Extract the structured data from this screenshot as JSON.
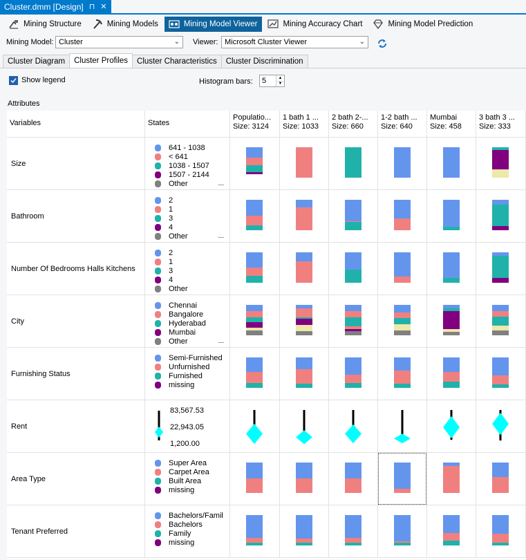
{
  "doc_tab": {
    "title": "Cluster.dmm [Design]",
    "pin_icon": "pin-icon",
    "close_icon": "close-icon"
  },
  "toolbar": [
    {
      "label": "Mining Structure",
      "icon": "mining-structure-icon",
      "active": false
    },
    {
      "label": "Mining Models",
      "icon": "pickaxe-icon",
      "active": false
    },
    {
      "label": "Mining Model Viewer",
      "icon": "viewer-icon",
      "active": true
    },
    {
      "label": "Mining Accuracy Chart",
      "icon": "accuracy-chart-icon",
      "active": false
    },
    {
      "label": "Mining Model Prediction",
      "icon": "prediction-icon",
      "active": false
    }
  ],
  "mining_model": {
    "label": "Mining Model:",
    "value": "Cluster"
  },
  "viewer": {
    "label": "Viewer:",
    "value": "Microsoft Cluster Viewer"
  },
  "subtabs": [
    {
      "label": "Cluster Diagram",
      "active": false
    },
    {
      "label": "Cluster Profiles",
      "active": true
    },
    {
      "label": "Cluster Characteristics",
      "active": false
    },
    {
      "label": "Cluster Discrimination",
      "active": false
    }
  ],
  "show_legend": {
    "label": "Show legend",
    "checked": true
  },
  "histogram": {
    "label": "Histogram bars:",
    "value": "5"
  },
  "attributes_label": "Attributes",
  "columns": {
    "variables": "Variables",
    "states": "States",
    "clusters": [
      {
        "name": "Populatio...",
        "size": "Size: 3124"
      },
      {
        "name": "1 bath 1 ...",
        "size": "Size: 1033"
      },
      {
        "name": "2 bath 2-...",
        "size": "Size: 660"
      },
      {
        "name": "1-2 bath ...",
        "size": "Size: 640"
      },
      {
        "name": "Mumbai",
        "size": "Size: 458"
      },
      {
        "name": "3 bath 3 ...",
        "size": "Size: 333"
      }
    ]
  },
  "colors": {
    "blue": "#6495ed",
    "salmon": "#f08080",
    "teal": "#20b2aa",
    "purple": "#800080",
    "gray": "#808080",
    "khaki": "#eee8aa",
    "cyan": "#00ffff",
    "select_blue": "#0e639c"
  },
  "rows": [
    {
      "name": "Size",
      "states": [
        {
          "label": "641 - 1038",
          "color": "#6495ed"
        },
        {
          "label": "< 641",
          "color": "#f08080"
        },
        {
          "label": "1038 - 1507",
          "color": "#20b2aa"
        },
        {
          "label": "1507 - 2144",
          "color": "#800080"
        },
        {
          "label": "Other",
          "color": "#808080"
        }
      ],
      "has_more": true,
      "bars": [
        [
          {
            "v": 0.35,
            "c": "#6495ed"
          },
          {
            "v": 0.25,
            "c": "#f08080"
          },
          {
            "v": 0.22,
            "c": "#20b2aa"
          },
          {
            "v": 0.06,
            "c": "#800080"
          },
          {
            "v": 0.12,
            "c": "#ffffff"
          }
        ],
        [
          {
            "v": 1.0,
            "c": "#f08080"
          }
        ],
        [
          {
            "v": 1.0,
            "c": "#20b2aa"
          }
        ],
        [
          {
            "v": 1.0,
            "c": "#6495ed"
          }
        ],
        [
          {
            "v": 1.0,
            "c": "#6495ed"
          }
        ],
        [
          {
            "v": 0.08,
            "c": "#20b2aa"
          },
          {
            "v": 0.65,
            "c": "#800080"
          },
          {
            "v": 0.27,
            "c": "#eee8aa"
          }
        ]
      ]
    },
    {
      "name": "Bathroom",
      "states": [
        {
          "label": "2",
          "color": "#6495ed"
        },
        {
          "label": "1",
          "color": "#f08080"
        },
        {
          "label": "3",
          "color": "#20b2aa"
        },
        {
          "label": "4",
          "color": "#800080"
        },
        {
          "label": "Other",
          "color": "#808080"
        }
      ],
      "has_more": true,
      "bars": [
        [
          {
            "v": 0.52,
            "c": "#6495ed"
          },
          {
            "v": 0.33,
            "c": "#f08080"
          },
          {
            "v": 0.15,
            "c": "#20b2aa"
          }
        ],
        [
          {
            "v": 0.25,
            "c": "#6495ed"
          },
          {
            "v": 0.75,
            "c": "#f08080"
          }
        ],
        [
          {
            "v": 0.7,
            "c": "#6495ed"
          },
          {
            "v": 0.03,
            "c": "#f08080"
          },
          {
            "v": 0.27,
            "c": "#20b2aa"
          }
        ],
        [
          {
            "v": 0.62,
            "c": "#6495ed"
          },
          {
            "v": 0.38,
            "c": "#f08080"
          }
        ],
        [
          {
            "v": 0.88,
            "c": "#6495ed"
          },
          {
            "v": 0.12,
            "c": "#20b2aa"
          }
        ],
        [
          {
            "v": 0.15,
            "c": "#6495ed"
          },
          {
            "v": 0.72,
            "c": "#20b2aa"
          },
          {
            "v": 0.13,
            "c": "#800080"
          }
        ]
      ]
    },
    {
      "name": "Number Of Bedrooms Halls Kitchens",
      "states": [
        {
          "label": "2",
          "color": "#6495ed"
        },
        {
          "label": "1",
          "color": "#f08080"
        },
        {
          "label": "3",
          "color": "#20b2aa"
        },
        {
          "label": "4",
          "color": "#800080"
        },
        {
          "label": "Other",
          "color": "#808080"
        }
      ],
      "has_more": false,
      "bars": [
        [
          {
            "v": 0.49,
            "c": "#6495ed"
          },
          {
            "v": 0.29,
            "c": "#f08080"
          },
          {
            "v": 0.22,
            "c": "#20b2aa"
          }
        ],
        [
          {
            "v": 0.3,
            "c": "#6495ed"
          },
          {
            "v": 0.7,
            "c": "#f08080"
          }
        ],
        [
          {
            "v": 0.57,
            "c": "#6495ed"
          },
          {
            "v": 0.43,
            "c": "#20b2aa"
          }
        ],
        [
          {
            "v": 0.8,
            "c": "#6495ed"
          },
          {
            "v": 0.2,
            "c": "#f08080"
          }
        ],
        [
          {
            "v": 0.85,
            "c": "#6495ed"
          },
          {
            "v": 0.15,
            "c": "#20b2aa"
          }
        ],
        [
          {
            "v": 0.12,
            "c": "#6495ed"
          },
          {
            "v": 0.73,
            "c": "#20b2aa"
          },
          {
            "v": 0.15,
            "c": "#800080"
          }
        ]
      ]
    },
    {
      "name": "City",
      "states": [
        {
          "label": "Chennai",
          "color": "#6495ed"
        },
        {
          "label": "Bangalore",
          "color": "#f08080"
        },
        {
          "label": "Hyderabad",
          "color": "#20b2aa"
        },
        {
          "label": "Mumbai",
          "color": "#800080"
        },
        {
          "label": "Other",
          "color": "#808080"
        }
      ],
      "has_more": true,
      "bars": [
        [
          {
            "v": 0.2,
            "c": "#6495ed"
          },
          {
            "v": 0.2,
            "c": "#f08080"
          },
          {
            "v": 0.17,
            "c": "#20b2aa"
          },
          {
            "v": 0.17,
            "c": "#800080"
          },
          {
            "v": 0.1,
            "c": "#eee8aa"
          },
          {
            "v": 0.16,
            "c": "#808080"
          }
        ],
        [
          {
            "v": 0.12,
            "c": "#6495ed"
          },
          {
            "v": 0.28,
            "c": "#f08080"
          },
          {
            "v": 0.06,
            "c": "#20b2aa"
          },
          {
            "v": 0.2,
            "c": "#800080"
          },
          {
            "v": 0.2,
            "c": "#eee8aa"
          },
          {
            "v": 0.14,
            "c": "#808080"
          }
        ],
        [
          {
            "v": 0.2,
            "c": "#6495ed"
          },
          {
            "v": 0.2,
            "c": "#f08080"
          },
          {
            "v": 0.3,
            "c": "#20b2aa"
          },
          {
            "v": 0.1,
            "c": "#f08080"
          },
          {
            "v": 0.06,
            "c": "#800080"
          },
          {
            "v": 0.14,
            "c": "#808080"
          }
        ],
        [
          {
            "v": 0.24,
            "c": "#6495ed"
          },
          {
            "v": 0.2,
            "c": "#f08080"
          },
          {
            "v": 0.2,
            "c": "#20b2aa"
          },
          {
            "v": 0.2,
            "c": "#eee8aa"
          },
          {
            "v": 0.16,
            "c": "#808080"
          }
        ],
        [
          {
            "v": 0.12,
            "c": "#6495ed"
          },
          {
            "v": 0.08,
            "c": "#20b2aa"
          },
          {
            "v": 0.6,
            "c": "#800080"
          },
          {
            "v": 0.08,
            "c": "#eee8aa"
          },
          {
            "v": 0.12,
            "c": "#808080"
          }
        ],
        [
          {
            "v": 0.2,
            "c": "#6495ed"
          },
          {
            "v": 0.18,
            "c": "#f08080"
          },
          {
            "v": 0.3,
            "c": "#20b2aa"
          },
          {
            "v": 0.17,
            "c": "#eee8aa"
          },
          {
            "v": 0.15,
            "c": "#808080"
          }
        ]
      ]
    },
    {
      "name": "Furnishing Status",
      "states": [
        {
          "label": "Semi-Furnished",
          "color": "#6495ed"
        },
        {
          "label": "Unfurnished",
          "color": "#f08080"
        },
        {
          "label": "Furnished",
          "color": "#20b2aa"
        },
        {
          "label": "missing",
          "color": "#800080"
        }
      ],
      "has_more": false,
      "bars": [
        [
          {
            "v": 0.47,
            "c": "#6495ed"
          },
          {
            "v": 0.38,
            "c": "#f08080"
          },
          {
            "v": 0.15,
            "c": "#20b2aa"
          }
        ],
        [
          {
            "v": 0.38,
            "c": "#6495ed"
          },
          {
            "v": 0.48,
            "c": "#f08080"
          },
          {
            "v": 0.14,
            "c": "#20b2aa"
          }
        ],
        [
          {
            "v": 0.56,
            "c": "#6495ed"
          },
          {
            "v": 0.28,
            "c": "#f08080"
          },
          {
            "v": 0.16,
            "c": "#20b2aa"
          }
        ],
        [
          {
            "v": 0.43,
            "c": "#6495ed"
          },
          {
            "v": 0.44,
            "c": "#f08080"
          },
          {
            "v": 0.13,
            "c": "#20b2aa"
          }
        ],
        [
          {
            "v": 0.47,
            "c": "#6495ed"
          },
          {
            "v": 0.33,
            "c": "#f08080"
          },
          {
            "v": 0.2,
            "c": "#20b2aa"
          }
        ],
        [
          {
            "v": 0.58,
            "c": "#6495ed"
          },
          {
            "v": 0.3,
            "c": "#f08080"
          },
          {
            "v": 0.12,
            "c": "#20b2aa"
          }
        ]
      ]
    },
    {
      "name": "Rent",
      "is_continuous": true,
      "states_numeric": {
        "max": "83,567.53",
        "mean": "22,943.05",
        "min": "1,200.00"
      },
      "rent": [
        {
          "top": 0.0,
          "bottom": 0.88,
          "mean": 0.72,
          "spread": 0.9
        },
        {
          "top": 0.0,
          "bottom": 0.9,
          "mean": 0.82,
          "spread": 0.55
        },
        {
          "top": 0.0,
          "bottom": 0.9,
          "mean": 0.72,
          "spread": 0.82
        },
        {
          "top": 0.0,
          "bottom": 0.92,
          "mean": 0.86,
          "spread": 0.3
        },
        {
          "top": 0.0,
          "bottom": 0.9,
          "mean": 0.52,
          "spread": 1.0
        },
        {
          "top": 0.0,
          "bottom": 0.92,
          "mean": 0.42,
          "spread": 1.0
        }
      ],
      "legend_glyph": {
        "mean": 0.72
      }
    },
    {
      "name": "Area Type",
      "states": [
        {
          "label": "Super Area",
          "color": "#6495ed"
        },
        {
          "label": "Carpet Area",
          "color": "#f08080"
        },
        {
          "label": "Built Area",
          "color": "#20b2aa"
        },
        {
          "label": "missing",
          "color": "#800080"
        }
      ],
      "has_more": false,
      "bars": [
        [
          {
            "v": 0.52,
            "c": "#6495ed"
          },
          {
            "v": 0.48,
            "c": "#f08080"
          }
        ],
        [
          {
            "v": 0.52,
            "c": "#6495ed"
          },
          {
            "v": 0.48,
            "c": "#f08080"
          }
        ],
        [
          {
            "v": 0.52,
            "c": "#6495ed"
          },
          {
            "v": 0.48,
            "c": "#f08080"
          }
        ],
        [
          {
            "v": 0.86,
            "c": "#6495ed"
          },
          {
            "v": 0.14,
            "c": "#f08080"
          }
        ],
        [
          {
            "v": 0.12,
            "c": "#6495ed"
          },
          {
            "v": 0.88,
            "c": "#f08080"
          }
        ],
        [
          {
            "v": 0.48,
            "c": "#6495ed"
          },
          {
            "v": 0.52,
            "c": "#f08080"
          }
        ]
      ],
      "selected_cluster": 3
    },
    {
      "name": "Tenant Preferred",
      "states": [
        {
          "label": "Bachelors/Famil",
          "color": "#6495ed"
        },
        {
          "label": "Bachelors",
          "color": "#f08080"
        },
        {
          "label": "Family",
          "color": "#20b2aa"
        },
        {
          "label": "missing",
          "color": "#800080"
        }
      ],
      "has_more": false,
      "bars": [
        [
          {
            "v": 0.75,
            "c": "#6495ed"
          },
          {
            "v": 0.15,
            "c": "#f08080"
          },
          {
            "v": 0.1,
            "c": "#20b2aa"
          }
        ],
        [
          {
            "v": 0.78,
            "c": "#6495ed"
          },
          {
            "v": 0.14,
            "c": "#f08080"
          },
          {
            "v": 0.08,
            "c": "#20b2aa"
          }
        ],
        [
          {
            "v": 0.75,
            "c": "#6495ed"
          },
          {
            "v": 0.15,
            "c": "#f08080"
          },
          {
            "v": 0.1,
            "c": "#20b2aa"
          }
        ],
        [
          {
            "v": 0.86,
            "c": "#6495ed"
          },
          {
            "v": 0.06,
            "c": "#f08080"
          },
          {
            "v": 0.08,
            "c": "#20b2aa"
          }
        ],
        [
          {
            "v": 0.58,
            "c": "#6495ed"
          },
          {
            "v": 0.27,
            "c": "#f08080"
          },
          {
            "v": 0.15,
            "c": "#20b2aa"
          }
        ],
        [
          {
            "v": 0.62,
            "c": "#6495ed"
          },
          {
            "v": 0.28,
            "c": "#f08080"
          },
          {
            "v": 0.1,
            "c": "#20b2aa"
          }
        ]
      ]
    }
  ]
}
